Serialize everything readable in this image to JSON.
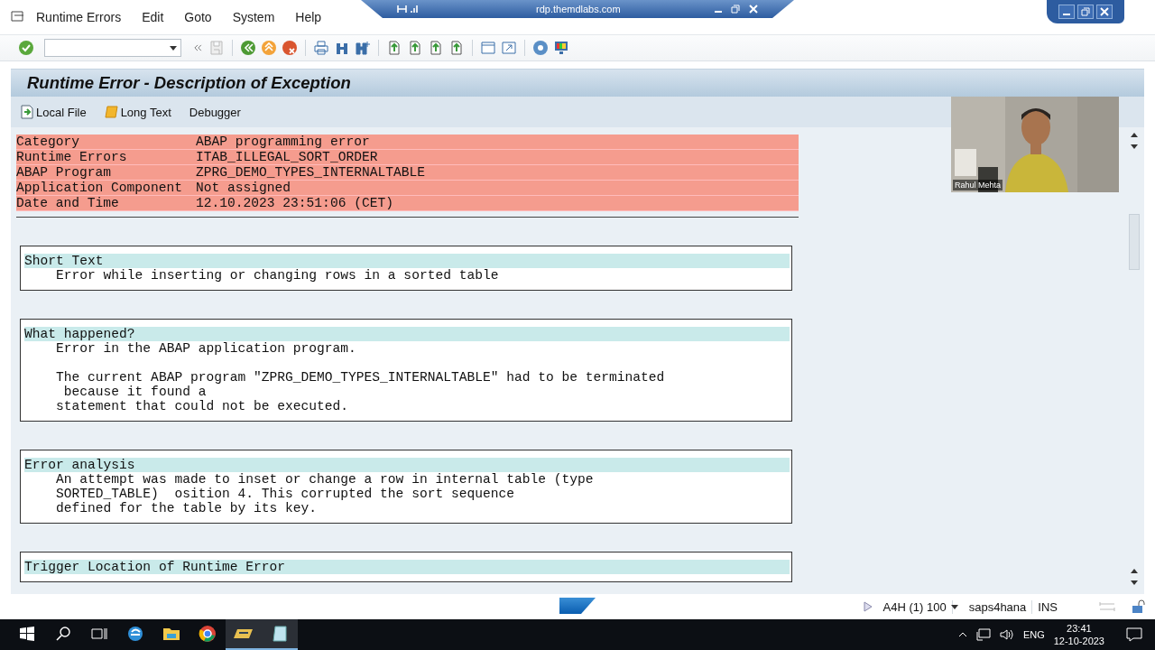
{
  "rdp_bar": {
    "title": "rdp.themdlabs.com"
  },
  "menu": [
    "Runtime Errors",
    "Edit",
    "Goto",
    "System",
    "Help"
  ],
  "title": "Runtime Error - Description of Exception",
  "app_toolbar": [
    {
      "label": "Local File",
      "kind": "file"
    },
    {
      "label": "Long Text",
      "kind": "scroll"
    },
    {
      "label": "Debugger",
      "kind": "plain"
    }
  ],
  "header_rows": [
    {
      "label": "Category",
      "value": "ABAP programming error"
    },
    {
      "label": "Runtime Errors",
      "value": "ITAB_ILLEGAL_SORT_ORDER"
    },
    {
      "label": "ABAP Program",
      "value": "ZPRG_DEMO_TYPES_INTERNALTABLE"
    },
    {
      "label": "Application Component",
      "value": "Not assigned"
    },
    {
      "label": "Date and Time",
      "value": "12.10.2023 23:51:06 (CET)"
    }
  ],
  "sections": [
    {
      "title": "Short Text",
      "paragraphs": [
        [
          "    Error while inserting or changing rows in a sorted table"
        ]
      ]
    },
    {
      "title": "What happened?",
      "paragraphs": [
        [
          "    Error in the ABAP application program."
        ],
        [
          "    The current ABAP program \"ZPRG_DEMO_TYPES_INTERNALTABLE\" had to be terminated",
          "     because it found a",
          "    statement that could not be executed."
        ]
      ]
    },
    {
      "title": "Error analysis",
      "paragraphs": [
        [
          "    An attempt was made to inset or change a row in internal table (type",
          "    SORTED_TABLE)  osition 4. This corrupted the sort sequence",
          "    defined for the table by its key."
        ]
      ]
    },
    {
      "title": "Trigger Location of Runtime Error"
    }
  ],
  "video": {
    "caption": "Rahul Mehta"
  },
  "status_bar": {
    "system": "A4H (1) 100",
    "server": "saps4hana",
    "mode": "INS"
  },
  "taskbar": {
    "language": "ENG",
    "time": "23:41",
    "date": "12-10-2023"
  }
}
